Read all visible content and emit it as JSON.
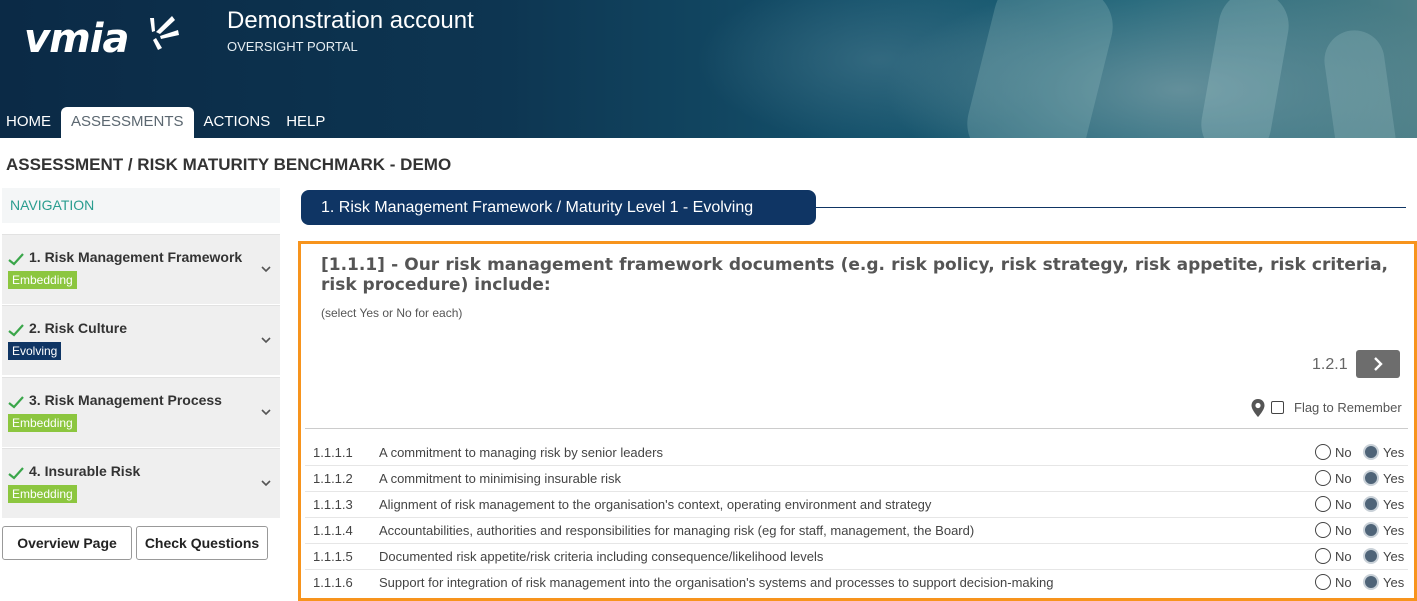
{
  "header": {
    "logo_text": "vmia",
    "account_title": "Demonstration account",
    "portal_label": "OVERSIGHT PORTAL"
  },
  "nav": {
    "items": [
      {
        "label": "HOME",
        "active": false
      },
      {
        "label": "ASSESSMENTS",
        "active": true
      },
      {
        "label": "ACTIONS",
        "active": false
      },
      {
        "label": "HELP",
        "active": false
      }
    ]
  },
  "breadcrumb": "ASSESSMENT / RISK MATURITY BENCHMARK - DEMO",
  "sidebar": {
    "heading": "NAVIGATION",
    "items": [
      {
        "title": "1. Risk Management Framework",
        "badge": "Embedding"
      },
      {
        "title": "2. Risk Culture",
        "badge": "Evolving"
      },
      {
        "title": "3. Risk Management Process",
        "badge": "Embedding"
      },
      {
        "title": "4. Insurable Risk",
        "badge": "Embedding"
      }
    ],
    "overview_button": "Overview Page",
    "check_button": "Check Questions"
  },
  "section": {
    "title": "1. Risk Management Framework / Maturity Level 1 - Evolving"
  },
  "question": {
    "title": "[1.1.1] - Our risk management framework documents (e.g. risk policy, risk strategy, risk appetite, risk criteria, risk procedure) include:",
    "hint": "(select Yes or No for each)",
    "next_label": "1.2.1",
    "flag_label": "Flag to Remember",
    "flag_checked": false,
    "rows": [
      {
        "num": "1.1.1.1",
        "text": "A commitment to managing risk by senior leaders",
        "no": "No",
        "yes": "Yes",
        "answer": "Yes"
      },
      {
        "num": "1.1.1.2",
        "text": "A commitment to minimising insurable risk",
        "no": "No",
        "yes": "Yes",
        "answer": "Yes"
      },
      {
        "num": "1.1.1.3",
        "text": "Alignment of risk management to the organisation's context, operating environment and strategy",
        "no": "No",
        "yes": "Yes",
        "answer": "Yes"
      },
      {
        "num": "1.1.1.4",
        "text": "Accountabilities, authorities and responsibilities for managing risk (eg for staff, management, the Board)",
        "no": "No",
        "yes": "Yes",
        "answer": "Yes"
      },
      {
        "num": "1.1.1.5",
        "text": "Documented risk appetite/risk criteria including consequence/likelihood levels",
        "no": "No",
        "yes": "Yes",
        "answer": "Yes"
      },
      {
        "num": "1.1.1.6",
        "text": "Support for integration of risk management into the organisation's systems and processes to support decision-making",
        "no": "No",
        "yes": "Yes",
        "answer": "Yes"
      }
    ]
  },
  "colors": {
    "navy": "#0f3564",
    "embedding": "#8cc63f",
    "accent_border": "#f7941d",
    "teal": "#2a9d8f"
  }
}
